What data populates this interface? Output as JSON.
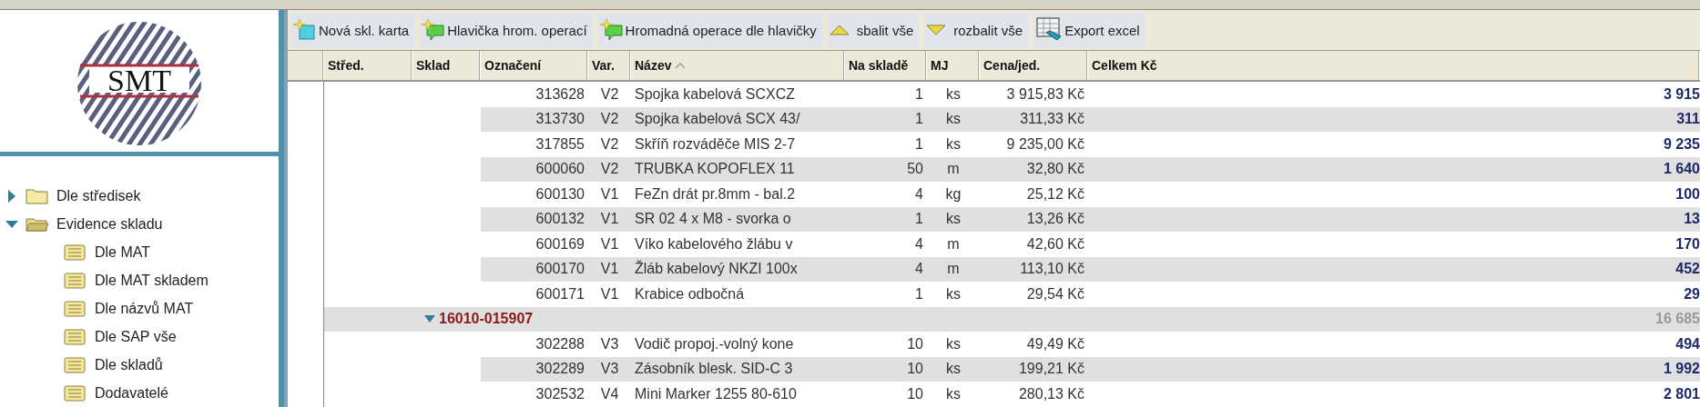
{
  "logo": {
    "text": "SMT"
  },
  "tree": [
    {
      "label": "Dle středisek",
      "kind": "folder",
      "expanded": false
    },
    {
      "label": "Evidence skladu",
      "kind": "folder",
      "expanded": true,
      "children": [
        {
          "label": "Dle MAT",
          "kind": "report"
        },
        {
          "label": "Dle MAT skladem",
          "kind": "report"
        },
        {
          "label": "Dle názvů MAT",
          "kind": "report"
        },
        {
          "label": "Dle SAP vše",
          "kind": "report"
        },
        {
          "label": "Dle skladů",
          "kind": "report"
        },
        {
          "label": "Dodavatelé",
          "kind": "report"
        }
      ]
    }
  ],
  "toolbar": [
    {
      "label": "Nová skl. karta",
      "kind": "new-card"
    },
    {
      "label": "Hlavička hrom. operací",
      "kind": "new-note"
    },
    {
      "label": "Hromadná operace dle hlavičky",
      "kind": "new-note"
    },
    {
      "label": "sbalit vše",
      "kind": "collapse"
    },
    {
      "label": "rozbalit vše",
      "kind": "expand"
    },
    {
      "label": "Export excel",
      "kind": "excel"
    }
  ],
  "table": {
    "columns": [
      {
        "label": "Střed.",
        "sorted": false
      },
      {
        "label": "Sklad",
        "sorted": false
      },
      {
        "label": "Označení",
        "sorted": false
      },
      {
        "label": "Var.",
        "sorted": false
      },
      {
        "label": "Název",
        "sorted": true
      },
      {
        "label": "Na skladě",
        "sorted": false
      },
      {
        "label": "MJ",
        "sorted": false
      },
      {
        "label": "Cena/jed.",
        "sorted": false
      },
      {
        "label": "Celkem Kč",
        "sorted": false
      }
    ],
    "rows": [
      {
        "kind": "item",
        "code": "313628",
        "variant": "V2",
        "name": "Spojka kabelová SCXCZ",
        "stock": "1",
        "unit": "ks",
        "price": "3 915,83 Kč",
        "total": "3 915"
      },
      {
        "kind": "item",
        "code": "313730",
        "variant": "V2",
        "name": "Spojka kabelová SCX 43/",
        "stock": "1",
        "unit": "ks",
        "price": "311,33 Kč",
        "total": "311"
      },
      {
        "kind": "item",
        "code": "317855",
        "variant": "V2",
        "name": "Skříň rozváděče MIS 2-7",
        "stock": "1",
        "unit": "ks",
        "price": "9 235,00 Kč",
        "total": "9 235"
      },
      {
        "kind": "item",
        "code": "600060",
        "variant": "V2",
        "name": "TRUBKA KOPOFLEX 11",
        "stock": "50",
        "unit": "m",
        "price": "32,80 Kč",
        "total": "1 640"
      },
      {
        "kind": "item",
        "code": "600130",
        "variant": "V1",
        "name": "FeZn drát pr.8mm - bal.2",
        "stock": "4",
        "unit": "kg",
        "price": "25,12 Kč",
        "total": "100"
      },
      {
        "kind": "item",
        "code": "600132",
        "variant": "V1",
        "name": "SR 02 4 x M8 - svorka o",
        "stock": "1",
        "unit": "ks",
        "price": "13,26 Kč",
        "total": "13"
      },
      {
        "kind": "item",
        "code": "600169",
        "variant": "V1",
        "name": "Víko kabelového žlábu v",
        "stock": "4",
        "unit": "m",
        "price": "42,60 Kč",
        "total": "170"
      },
      {
        "kind": "item",
        "code": "600170",
        "variant": "V1",
        "name": "Žláb kabelový NKZI 100x",
        "stock": "4",
        "unit": "m",
        "price": "113,10 Kč",
        "total": "452"
      },
      {
        "kind": "item",
        "code": "600171",
        "variant": "V1",
        "name": "Krabice odbočná",
        "stock": "1",
        "unit": "ks",
        "price": "29,54 Kč",
        "total": "29"
      },
      {
        "kind": "group",
        "label": "16010-015907",
        "expanded": true,
        "total": "16 685"
      },
      {
        "kind": "item",
        "code": "302288",
        "variant": "V3",
        "name": "Vodič propoj.-volný kone",
        "stock": "10",
        "unit": "ks",
        "price": "49,49 Kč",
        "total": "494"
      },
      {
        "kind": "item",
        "code": "302289",
        "variant": "V3",
        "name": "Zásobník blesk. SID-C 3",
        "stock": "10",
        "unit": "ks",
        "price": "199,21 Kč",
        "total": "1 992"
      },
      {
        "kind": "item",
        "code": "302532",
        "variant": "V4",
        "name": "Mini Marker 1255 80-610",
        "stock": "10",
        "unit": "ks",
        "price": "280,13 Kč",
        "total": "2 801"
      }
    ]
  }
}
